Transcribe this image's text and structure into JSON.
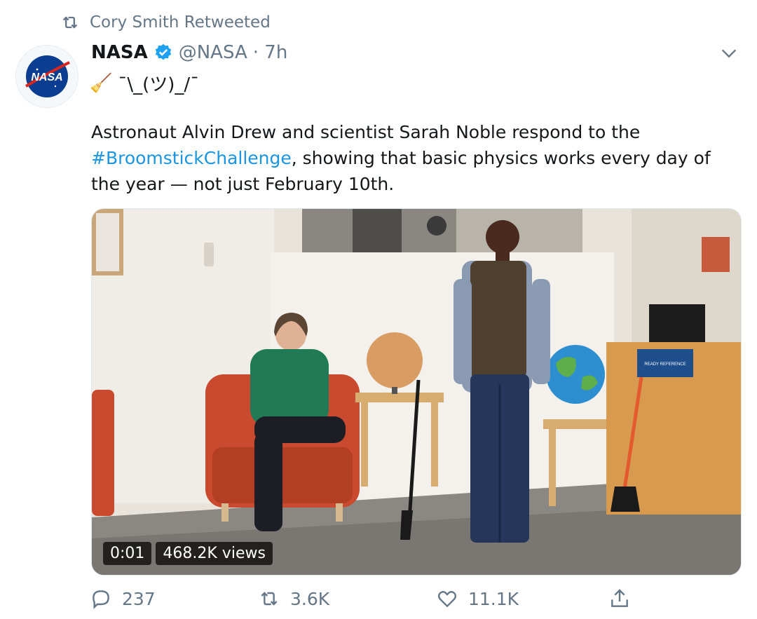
{
  "retweet": {
    "text": "Cory Smith Retweeted"
  },
  "author": {
    "name": "NASA",
    "handle": "@NASA",
    "time": "· 7h",
    "avatar_text": "NASA"
  },
  "subline": {
    "emoji": "🧹",
    "shrug": "¯\\_(ツ)_/¯"
  },
  "tweet": {
    "text_part1": "Astronaut Alvin Drew and scientist Sarah Noble respond to the ",
    "hashtag": "#BroomstickChallenge",
    "text_part2": ", showing that basic physics works every day of the year — not just February 10th."
  },
  "video": {
    "timestamp": "0:01",
    "views": "468.2K views",
    "sign_text": "READY REFERENCE"
  },
  "actions": {
    "replies": "237",
    "retweets": "3.6K",
    "likes": "11.1K"
  },
  "colors": {
    "link": "#1b95e0",
    "muted": "#657786",
    "verified": "#1da1f2"
  }
}
